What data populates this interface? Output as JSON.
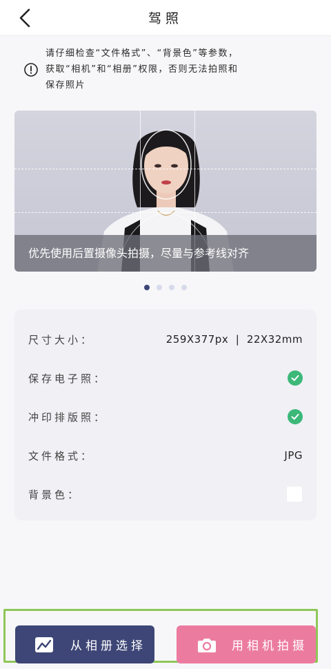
{
  "header": {
    "title": "驾照"
  },
  "notice": {
    "lines": [
      "请仔细检查“文件格式”、“背景色”等参数，",
      "获取“相机”和“相册”权限，否则无法拍照和",
      "保存照片"
    ]
  },
  "preview": {
    "caption": "优先使用后置摄像头拍摄，尽量与参考线对齐",
    "carousel": {
      "total": 4,
      "active_index": 0
    }
  },
  "specs": {
    "size_label": "尺寸大小：",
    "size_value": "259X377px  |  22X32mm",
    "digital_label": "保存电子照：",
    "print_label": "冲印排版照：",
    "format_label": "文件格式：",
    "format_value": "JPG",
    "bg_label": "背景色：",
    "bg_color": "#ffffff"
  },
  "actions": {
    "album_label": "从相册选择",
    "camera_label": "用相机拍摄"
  },
  "colors": {
    "album_button": "#3d4676",
    "camera_button": "#ec7ba0",
    "check": "#3cb878",
    "highlight_frame": "#8fc658"
  }
}
